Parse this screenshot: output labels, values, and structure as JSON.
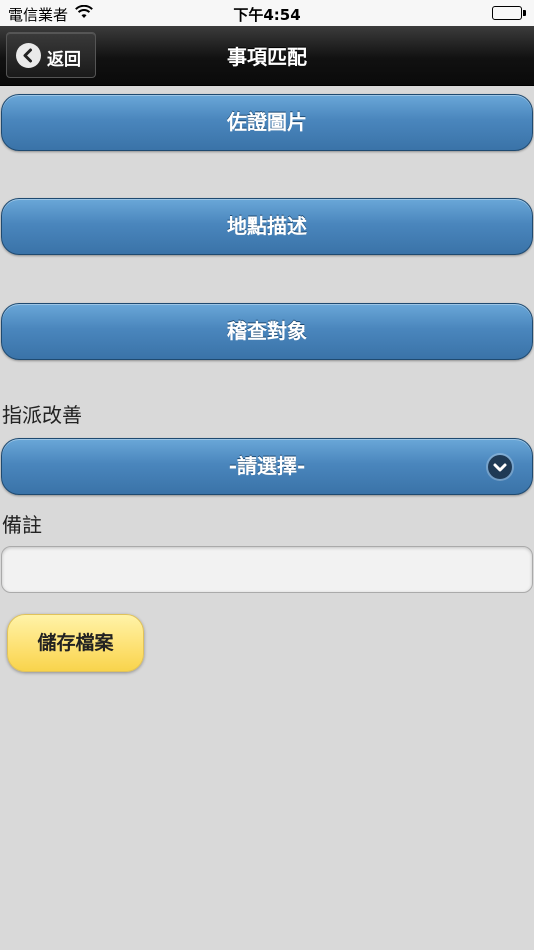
{
  "status_bar": {
    "carrier": "電信業者",
    "time": "下午4:54",
    "battery_level": 1.0
  },
  "header": {
    "back_label": "返回",
    "title": "事項匹配"
  },
  "buttons": {
    "evidence_photo": "佐證圖片",
    "location_description": "地點描述",
    "inspection_target": "稽查對象"
  },
  "assign_improvement": {
    "label": "指派改善",
    "selected": "-請選擇-"
  },
  "notes": {
    "label": "備註",
    "value": "",
    "placeholder": ""
  },
  "save_label": "儲存檔案",
  "colors": {
    "button_blue": "#4a86bd",
    "save_yellow": "#fde070",
    "header_dark": "#111111",
    "background": "#d9d9d9"
  }
}
